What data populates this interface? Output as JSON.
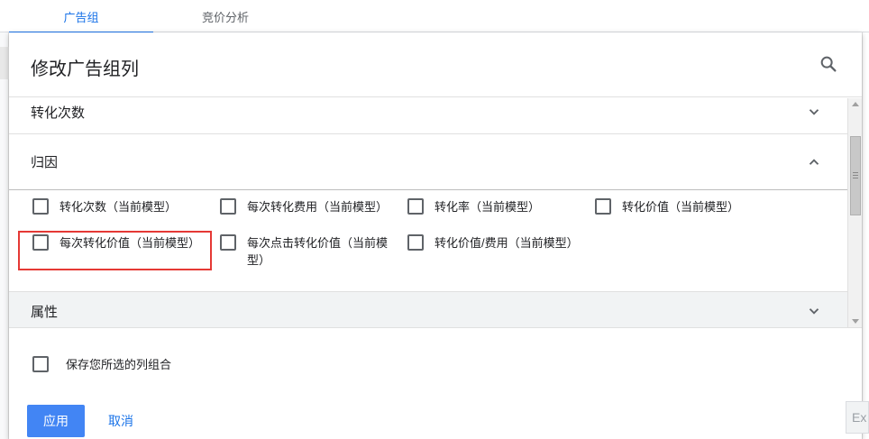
{
  "tabs": [
    {
      "label": "广告组",
      "active": true
    },
    {
      "label": "竞价分析",
      "active": false
    }
  ],
  "dialog": {
    "title": "修改广告组列",
    "search_icon": "search-icon"
  },
  "sections": {
    "conversions": {
      "label": "转化次数",
      "expanded": false
    },
    "attribution": {
      "label": "归因",
      "expanded": true,
      "options": [
        {
          "label": "转化次数（当前模型）",
          "checked": false
        },
        {
          "label": "每次转化费用（当前模型）",
          "checked": false
        },
        {
          "label": "转化率（当前模型）",
          "checked": false
        },
        {
          "label": "转化价值（当前模型）",
          "checked": false
        },
        {
          "label": "每次转化价值（当前模型）",
          "checked": false
        },
        {
          "label": "每次点击转化价值（当前模型）",
          "checked": false
        },
        {
          "label": "转化价值/费用（当前模型）",
          "checked": false
        }
      ]
    },
    "properties": {
      "label": "属性",
      "expanded": false
    }
  },
  "footer": {
    "save_combo_label": "保存您所选的列组合",
    "apply_label": "应用",
    "cancel_label": "取消"
  },
  "overflow_button_label": "Ex",
  "colors": {
    "accent": "#1a73e8",
    "apply_button": "#4285f4",
    "highlight_box": "#e53935"
  }
}
